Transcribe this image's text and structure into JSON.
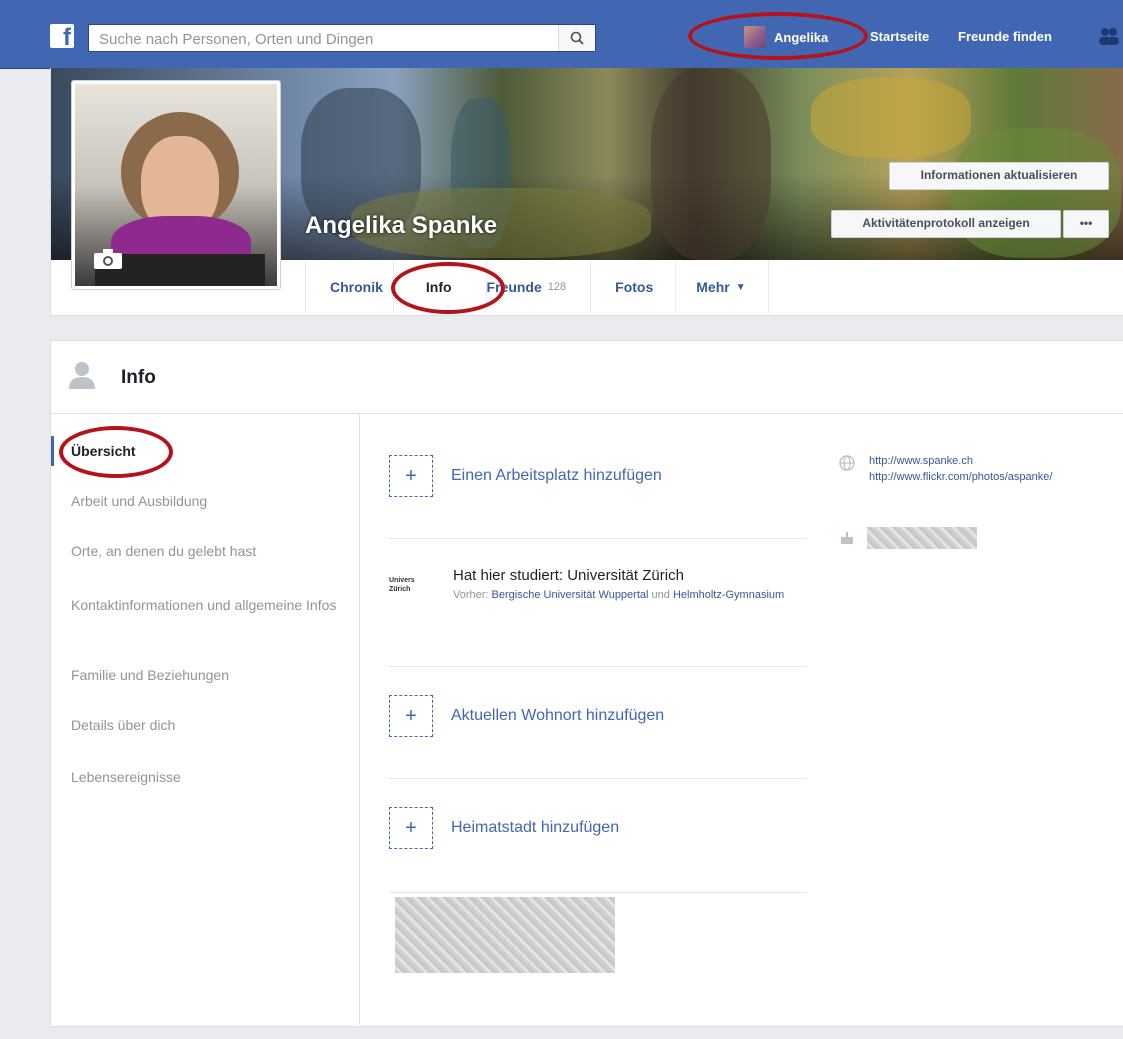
{
  "topbar": {
    "logo_letter": "f",
    "search_placeholder": "Suche nach Personen, Orten und Dingen",
    "user_name": "Angelika",
    "nav_home": "Startseite",
    "nav_find_friends": "Freunde finden"
  },
  "profile": {
    "name": "Angelika Spanke",
    "update_info_button": "Informationen aktualisieren",
    "activity_log_button": "Aktivitätenprotokoll anzeigen",
    "more_button": "•••",
    "tabs": [
      {
        "label": "Chronik"
      },
      {
        "label": "Info"
      },
      {
        "label": "Freunde",
        "count": "128"
      },
      {
        "label": "Fotos"
      },
      {
        "label": "Mehr",
        "caret": "▼"
      }
    ]
  },
  "info": {
    "title": "Info",
    "sidebar": [
      "Übersicht",
      "Arbeit und Ausbildung",
      "Orte, an denen du gelebt hast",
      "Kontaktinformationen und allgemeine Infos",
      "Familie und Beziehungen",
      "Details über dich",
      "Lebensereignisse"
    ],
    "add_workplace": "Einen Arbeitsplatz hinzufügen",
    "education": {
      "logo_text": "Univers Zürich",
      "title": "Hat hier studiert: Universität Zürich",
      "before_label": "Vorher:",
      "before_school_1": "Bergische Universität Wuppertal",
      "and": "und",
      "before_school_2": "Helmholtz-Gymnasium"
    },
    "add_current_city": "Aktuellen Wohnort hinzufügen",
    "add_hometown": "Heimatstadt hinzufügen",
    "plus": "+",
    "website_1": "http://www.spanke.ch",
    "website_2": "http://www.flickr.com/photos/aspanke/"
  },
  "colors": {
    "brand_blue": "#4267b2",
    "link_blue": "#365899",
    "highlight_ring": "#b5121b"
  }
}
